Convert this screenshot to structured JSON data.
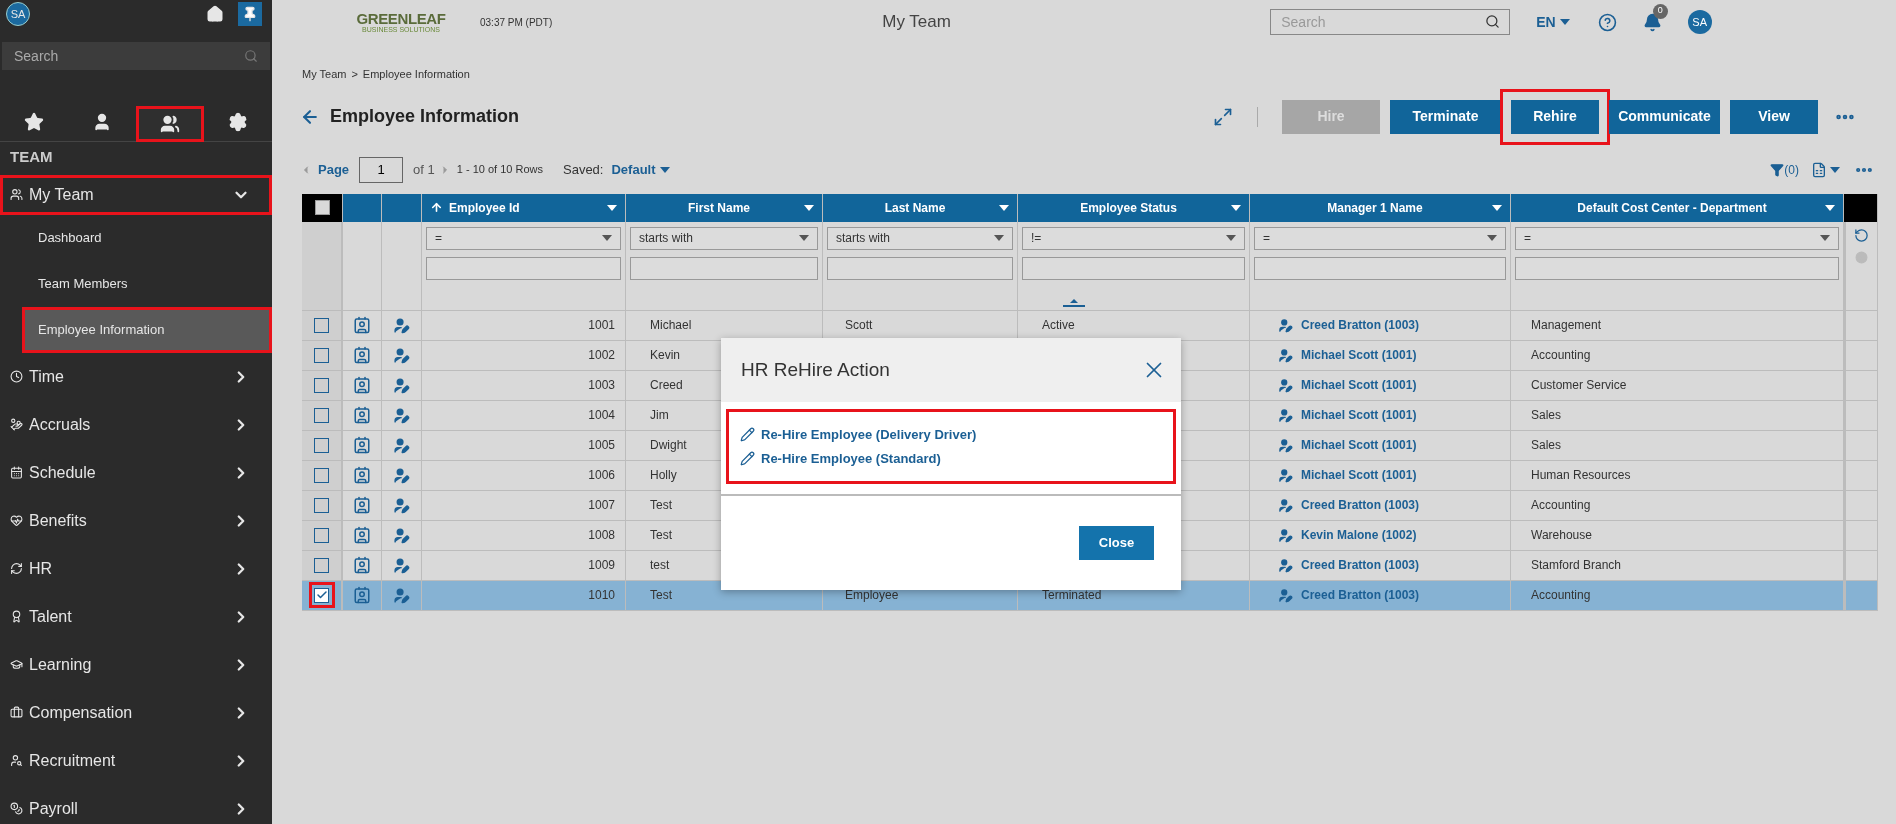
{
  "sidebar": {
    "avatar": "SA",
    "search": {
      "placeholder": "Search"
    },
    "tabs": [
      {
        "selected": false,
        "annotated": false
      },
      {
        "selected": false,
        "annotated": false
      },
      {
        "selected": true,
        "annotated": true
      },
      {
        "selected": false,
        "annotated": false
      }
    ],
    "section": "TEAM",
    "items": [
      {
        "label": "My Team",
        "expanded": true,
        "annotated": true,
        "children": [
          {
            "label": "Dashboard",
            "selected": false,
            "annotated": false
          },
          {
            "label": "Team Members",
            "selected": false,
            "annotated": false
          },
          {
            "label": "Employee Information",
            "selected": true,
            "annotated": true
          }
        ]
      },
      {
        "label": "Time",
        "expanded": false,
        "annotated": false
      },
      {
        "label": "Accruals",
        "expanded": false,
        "annotated": false
      },
      {
        "label": "Schedule",
        "expanded": false,
        "annotated": false
      },
      {
        "label": "Benefits",
        "expanded": false,
        "annotated": false
      },
      {
        "label": "HR",
        "expanded": false,
        "annotated": false
      },
      {
        "label": "Talent",
        "expanded": false,
        "annotated": false
      },
      {
        "label": "Learning",
        "expanded": false,
        "annotated": false
      },
      {
        "label": "Compensation",
        "expanded": false,
        "annotated": false
      },
      {
        "label": "Recruitment",
        "expanded": false,
        "annotated": false
      },
      {
        "label": "Payroll",
        "expanded": false,
        "annotated": false
      }
    ]
  },
  "topbar": {
    "logo_top": "GREENLEAF",
    "logo_bottom": "BUSINESS SOLUTIONS",
    "time": "03:37 PM (PDT)",
    "title": "My Team",
    "search": {
      "placeholder": "Search"
    },
    "language": "EN",
    "notifications": "0",
    "avatar": "SA"
  },
  "breadcrumb": [
    "My Team",
    ">",
    "Employee Information"
  ],
  "heading": "Employee Information",
  "actions": [
    {
      "label": "Hire",
      "disabled": true,
      "annotated": false
    },
    {
      "label": "Terminate",
      "disabled": false,
      "annotated": false
    },
    {
      "label": "Rehire",
      "disabled": false,
      "annotated": true
    },
    {
      "label": "Communicate",
      "disabled": false,
      "annotated": false
    },
    {
      "label": "View",
      "disabled": false,
      "annotated": false
    }
  ],
  "pager": {
    "label": "Page",
    "page": "1",
    "of": "of 1",
    "rows": "1 - 10 of 10 Rows",
    "saved_label": "Saved:",
    "saved_view": "Default",
    "filter_count": "(0)"
  },
  "table": {
    "select_all_checked": false,
    "columns": [
      {
        "label": "Employee Id",
        "sorted": true,
        "operator": "="
      },
      {
        "label": "First Name",
        "sorted": false,
        "operator": "starts with"
      },
      {
        "label": "Last Name",
        "sorted": false,
        "operator": "starts with"
      },
      {
        "label": "Employee Status",
        "sorted": false,
        "operator": "!="
      },
      {
        "label": "Manager 1 Name",
        "sorted": false,
        "operator": "="
      },
      {
        "label": "Default Cost Center - Department",
        "sorted": false,
        "operator": "="
      }
    ],
    "rows": [
      {
        "id": "1001",
        "first": "Michael",
        "last": "Scott",
        "status": "Active",
        "manager": "Creed Bratton (1003)",
        "department": "Management",
        "checked": false,
        "selected": false,
        "annotated": false
      },
      {
        "id": "1002",
        "first": "Kevin",
        "manager": "Michael Scott (1001)",
        "department": "Accounting",
        "checked": false,
        "selected": false,
        "annotated": false
      },
      {
        "id": "1003",
        "first": "Creed",
        "manager": "Michael Scott (1001)",
        "department": "Customer Service",
        "checked": false,
        "selected": false,
        "annotated": false
      },
      {
        "id": "1004",
        "first": "Jim",
        "manager": "Michael Scott (1001)",
        "department": "Sales",
        "checked": false,
        "selected": false,
        "annotated": false
      },
      {
        "id": "1005",
        "first": "Dwight",
        "manager": "Michael Scott (1001)",
        "department": "Sales",
        "checked": false,
        "selected": false,
        "annotated": false
      },
      {
        "id": "1006",
        "first": "Holly",
        "manager": "Michael Scott (1001)",
        "department": "Human Resources",
        "checked": false,
        "selected": false,
        "annotated": false
      },
      {
        "id": "1007",
        "first": "Test",
        "manager": "Creed Bratton (1003)",
        "department": "Accounting",
        "checked": false,
        "selected": false,
        "annotated": false
      },
      {
        "id": "1008",
        "first": "Test",
        "manager": "Kevin Malone (1002)",
        "department": "Warehouse",
        "checked": false,
        "selected": false,
        "annotated": false
      },
      {
        "id": "1009",
        "first": "test",
        "manager": "Creed Bratton (1003)",
        "department": "Stamford Branch",
        "checked": false,
        "selected": false,
        "annotated": false
      },
      {
        "id": "1010",
        "first": "Test",
        "last": "Employee",
        "status": "Terminated",
        "manager": "Creed Bratton (1003)",
        "department": "Accounting",
        "checked": true,
        "selected": true,
        "annotated": true
      }
    ]
  },
  "modal": {
    "title": "HR ReHire Action",
    "links": [
      "Re-Hire Employee (Delivery Driver)",
      "Re-Hire Employee (Standard)"
    ],
    "links_annotated": true,
    "close": "Close"
  }
}
